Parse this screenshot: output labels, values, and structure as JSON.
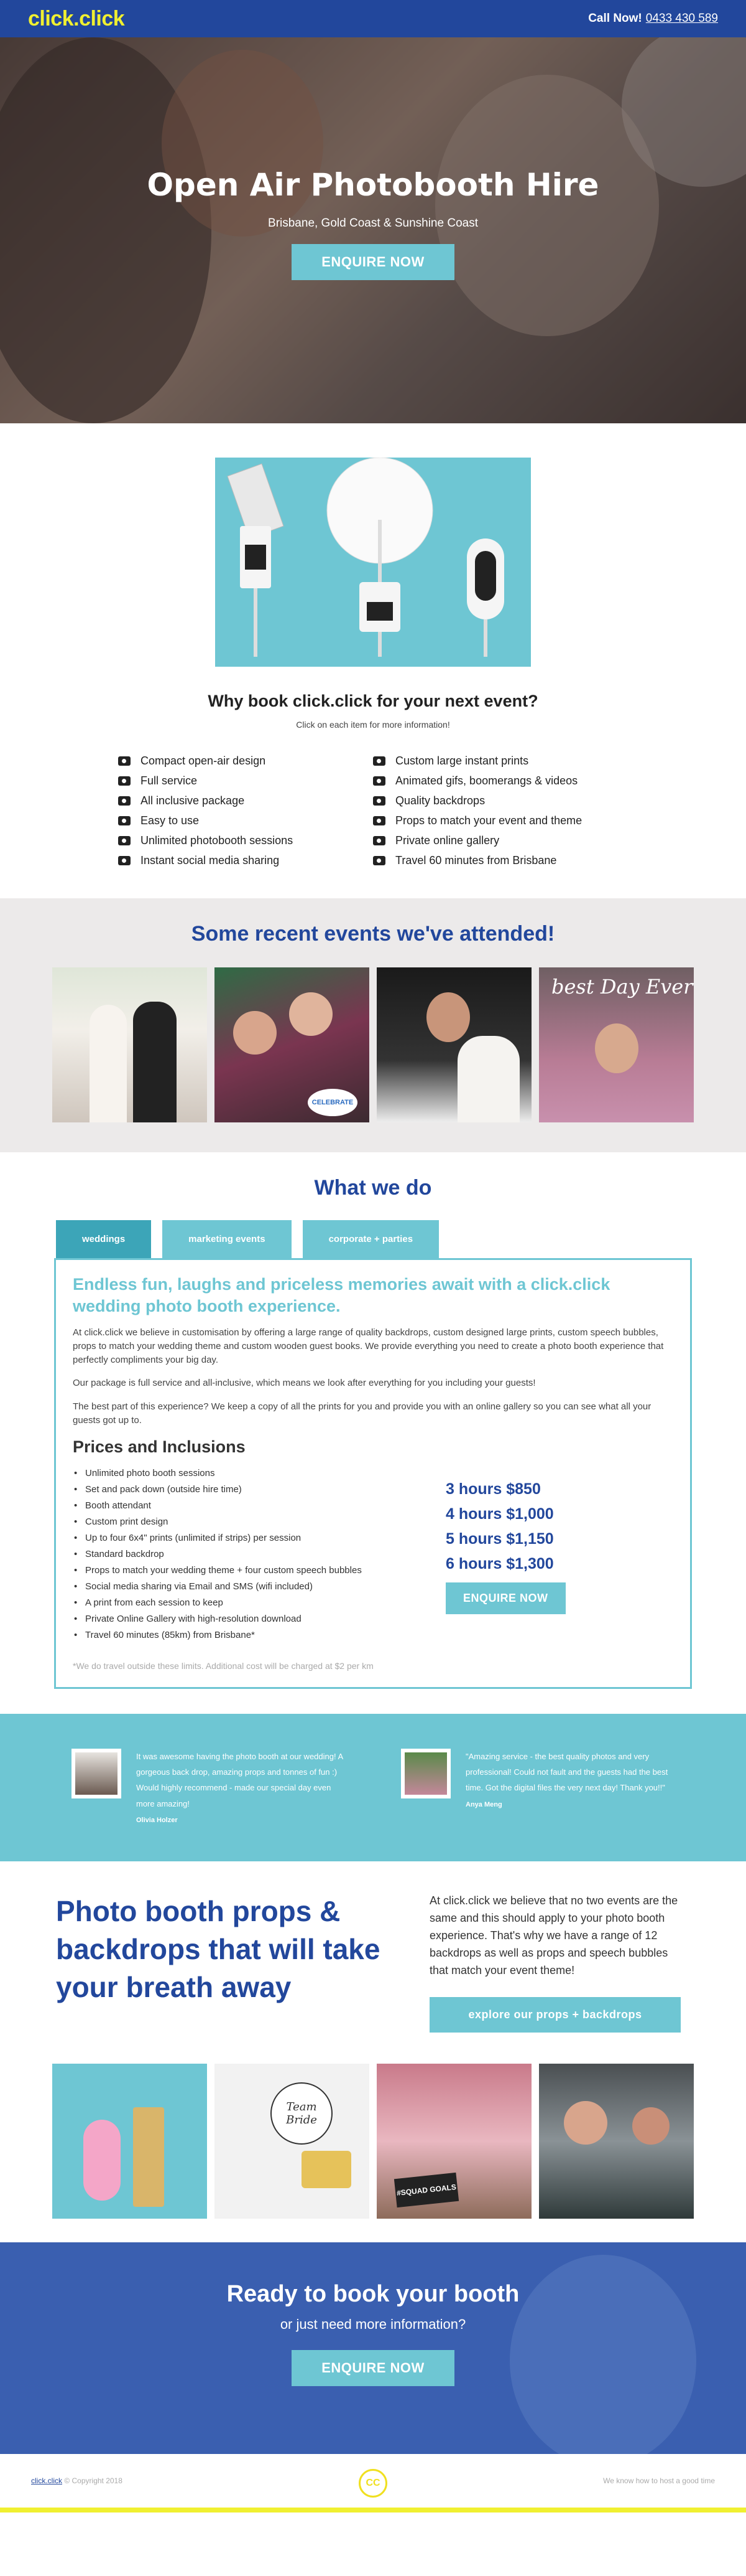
{
  "header": {
    "logo": "click.click",
    "call_label": "Call Now!",
    "phone": "0433 430 589"
  },
  "hero": {
    "title": "Open Air Photobooth Hire",
    "subtitle": "Brisbane, Gold Coast & Sunshine Coast",
    "button": "ENQUIRE NOW"
  },
  "why": {
    "title": "Why book click.click for your next event?",
    "subtitle": "Click on each item for more information!",
    "features_left": [
      "Compact open-air design",
      "Full service",
      "All inclusive package",
      "Easy to use",
      "Unlimited photobooth sessions",
      "Instant social media sharing"
    ],
    "features_right": [
      "Custom large instant prints",
      "Animated gifs, boomerangs & videos",
      "Quality backdrops",
      "Props to match your event and theme",
      "Private online gallery",
      "Travel 60 minutes from Brisbane"
    ]
  },
  "recent": {
    "title": "Some recent events we've attended!",
    "sticker": "CELEBRATE",
    "backdrop_text": "best Day Ever"
  },
  "whatwedo": {
    "title": "What we do",
    "tabs": [
      "weddings",
      "marketing events",
      "corporate + parties"
    ],
    "heading": "Endless fun, laughs and priceless memories await with a click.click wedding photo booth experience.",
    "para1": "At click.click we believe in customisation by offering a large range of quality backdrops, custom designed large prints, custom speech bubbles, props to match your wedding theme and custom wooden guest books. We provide everything you need to create a photo booth experience that perfectly compliments your big day.",
    "para2": "Our package is full service and all-inclusive, which means we look after everything for you including your guests!",
    "para3": "The best part of this experience? We keep a copy of all the prints for you and provide you with an online gallery so you can see what all your guests got up to.",
    "prices_title": "Prices and Inclusions",
    "inclusions": [
      "Unlimited photo booth sessions",
      "Set and pack down (outside hire time)",
      "Booth attendant",
      "Custom print design",
      "Up to four 6x4\" prints (unlimited if strips) per session",
      "Standard backdrop",
      "Props to match your wedding theme + four custom speech bubbles",
      "Social media sharing via Email and SMS (wifi included)",
      "A print from each session to keep",
      "Private Online Gallery with high-resolution download",
      "Travel 60 minutes (85km) from Brisbane*"
    ],
    "prices": [
      "3 hours $850",
      "4 hours $1,000",
      "5 hours $1,150",
      "6 hours $1,300"
    ],
    "button": "ENQUIRE NOW",
    "note": "*We do travel outside these limits. Additional cost will be charged at $2 per km"
  },
  "testimonials": [
    {
      "quote": "It was awesome having the photo booth at our wedding! A gorgeous back drop, amazing props and tonnes of fun :) Would highly recommend - made our special day even more amazing!",
      "name": "Olivia Holzer"
    },
    {
      "quote": "\"Amazing service - the best quality photos and very professional! Could not fault and the guests had the best time. Got the digital files the very next day! Thank you!!\"",
      "name": "Anya Meng"
    }
  ],
  "props": {
    "title": "Photo booth props & backdrops that will take your breath away",
    "text": "At click.click we believe that no two events are the same and this should apply to your photo booth experience. That's why we have a range of 12 backdrops as well as props and speech bubbles that match your event theme!",
    "button": "explore our props + backdrops",
    "badge1": "Team Bride",
    "badge2": "#SQUAD GOALS"
  },
  "cta": {
    "title": "Ready to book your booth",
    "subtitle": "or just need more information?",
    "button": "ENQUIRE NOW"
  },
  "footer": {
    "link": "click.click",
    "copyright": "© Copyright 2018",
    "logo": "CC",
    "tagline": "We know how to host a good time"
  },
  "colors": {
    "navy": "#22479c",
    "teal": "#6ec6d3",
    "yellow": "#f0f030"
  }
}
